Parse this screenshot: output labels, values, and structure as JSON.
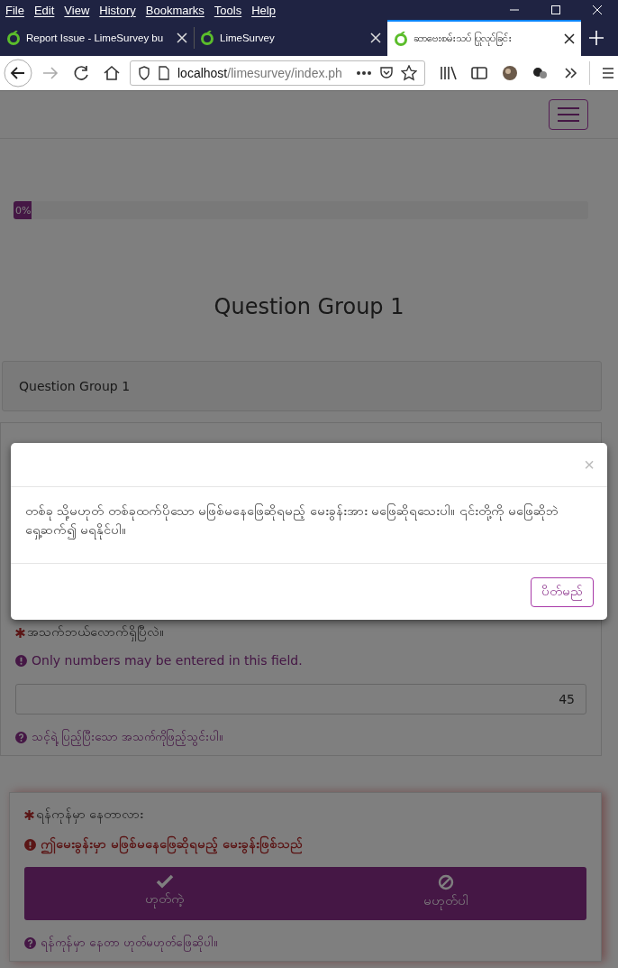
{
  "menu_bar": [
    "File",
    "Edit",
    "View",
    "History",
    "Bookmarks",
    "Tools",
    "Help"
  ],
  "tabs": [
    {
      "label": "Report Issue - LimeSurvey bu",
      "selected": false
    },
    {
      "label": "LimeSurvey",
      "selected": false
    },
    {
      "label": "ဆာဗေးစမ်းသပ် ပြုလုပ်ခြင်း",
      "selected": true
    }
  ],
  "address_bar": {
    "host": "localhost",
    "path": "/limesurvey/index.ph"
  },
  "progress": {
    "level": 0,
    "label": "0%"
  },
  "group_title": "Question Group 1",
  "group_description": "Question Group 1",
  "questions": [
    {
      "kind": "numeric",
      "required": true,
      "text": "အသက်ဘယ်လောက်ရှိပြီလဲ။",
      "tip": "Only numbers may be entered in this field.",
      "tip_error": false,
      "value": "45",
      "help": "သင့်ရဲ့ ပြည့်ပြီးသော အသက်ကိုဖြည့်သွင်းပါ။"
    },
    {
      "kind": "yesno",
      "required": true,
      "text": "ရန်ကုန်မှာ နေတာလား",
      "tip": "ဤမေးခွန်းမှာ မဖြစ်မနေဖြေဆိုရမည့် မေးခွန်းဖြစ်သည်",
      "tip_error": true,
      "options": [
        {
          "label": "ဟုတ်ကဲ့",
          "selected": false
        },
        {
          "label": "မဟုတ်ပါ",
          "selected": false
        }
      ],
      "help": "ရန်ကုန်မှာ နေတာ ဟုတ်မဟုတ်ဖြေဆိုပါ။"
    }
  ],
  "modal": {
    "close": "×",
    "message": "တစ်ခု သို့မဟုတ် တစ်ခုထက်ပိုသော မဖြစ်မနေဖြေဆိုရမည့် မေးခွန်းအား မဖြေဆိုရသေးပါ။ ၎င်းတို့ကို မဖြေဆိုဘဲ ရှေ့ဆက်၍ မရနိုင်ပါ။",
    "button": "ပိတ်မည်"
  }
}
